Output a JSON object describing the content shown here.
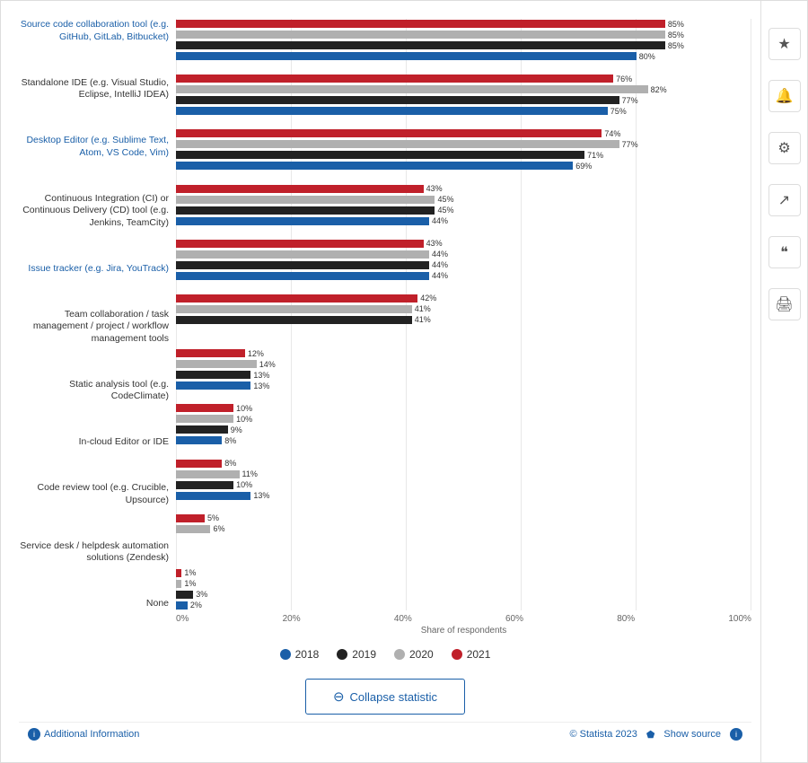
{
  "sidebar": {
    "icons": [
      {
        "name": "star-icon",
        "symbol": "★"
      },
      {
        "name": "bell-icon",
        "symbol": "🔔"
      },
      {
        "name": "gear-icon",
        "symbol": "⚙"
      },
      {
        "name": "share-icon",
        "symbol": "↗"
      },
      {
        "name": "quote-icon",
        "symbol": "❝"
      },
      {
        "name": "print-icon",
        "symbol": "🖨"
      }
    ]
  },
  "chart": {
    "categories": [
      {
        "label": "Source code collaboration tool (e.g. GitHub, GitLab, Bitbucket)",
        "isLink": true,
        "bars": [
          {
            "year": "2018",
            "color": "#1a5fa8",
            "value": 80,
            "label": "80%"
          },
          {
            "year": "2019",
            "color": "#222222",
            "value": 85,
            "label": "85%"
          },
          {
            "year": "2020",
            "color": "#b0b0b0",
            "value": 85,
            "label": "85%"
          },
          {
            "year": "2021",
            "color": "#c0202a",
            "value": 85,
            "label": "85%"
          }
        ]
      },
      {
        "label": "Standalone IDE (e.g. Visual Studio, Eclipse, IntelliJ IDEA)",
        "isLink": false,
        "bars": [
          {
            "year": "2018",
            "color": "#1a5fa8",
            "value": 75,
            "label": "75%"
          },
          {
            "year": "2019",
            "color": "#222222",
            "value": 77,
            "label": "77%"
          },
          {
            "year": "2020",
            "color": "#b0b0b0",
            "value": 82,
            "label": "82%"
          },
          {
            "year": "2021",
            "color": "#c0202a",
            "value": 76,
            "label": "76%"
          }
        ]
      },
      {
        "label": "Desktop Editor (e.g. Sublime Text, Atom, VS Code, Vim)",
        "isLink": true,
        "bars": [
          {
            "year": "2018",
            "color": "#1a5fa8",
            "value": 69,
            "label": "69%"
          },
          {
            "year": "2019",
            "color": "#222222",
            "value": 71,
            "label": "71%"
          },
          {
            "year": "2020",
            "color": "#b0b0b0",
            "value": 77,
            "label": "77%"
          },
          {
            "year": "2021",
            "color": "#c0202a",
            "value": 74,
            "label": "74%"
          }
        ]
      },
      {
        "label": "Continuous Integration (CI) or Continuous Delivery (CD) tool (e.g. Jenkins, TeamCity)",
        "isLink": false,
        "bars": [
          {
            "year": "2018",
            "color": "#1a5fa8",
            "value": 44,
            "label": "44%"
          },
          {
            "year": "2019",
            "color": "#222222",
            "value": 45,
            "label": "45%"
          },
          {
            "year": "2020",
            "color": "#b0b0b0",
            "value": 45,
            "label": "45%"
          },
          {
            "year": "2021",
            "color": "#c0202a",
            "value": 43,
            "label": "43%"
          }
        ]
      },
      {
        "label": "Issue tracker (e.g. Jira, YouTrack)",
        "isLink": true,
        "bars": [
          {
            "year": "2018",
            "color": "#1a5fa8",
            "value": 44,
            "label": "44%"
          },
          {
            "year": "2019",
            "color": "#222222",
            "value": 44,
            "label": "44%"
          },
          {
            "year": "2020",
            "color": "#b0b0b0",
            "value": 44,
            "label": "44%"
          },
          {
            "year": "2021",
            "color": "#c0202a",
            "value": 43,
            "label": "43%"
          }
        ]
      },
      {
        "label": "Team collaboration / task management / project / workflow management tools",
        "isLink": false,
        "bars": [
          {
            "year": "2018",
            "color": "#1a5fa8",
            "value": 0,
            "label": ""
          },
          {
            "year": "2019",
            "color": "#222222",
            "value": 41,
            "label": "41%"
          },
          {
            "year": "2020",
            "color": "#b0b0b0",
            "value": 41,
            "label": "41%"
          },
          {
            "year": "2021",
            "color": "#c0202a",
            "value": 42,
            "label": "42%"
          }
        ]
      },
      {
        "label": "Static analysis tool (e.g. CodeClimate)",
        "isLink": false,
        "bars": [
          {
            "year": "2018",
            "color": "#1a5fa8",
            "value": 13,
            "label": "13%"
          },
          {
            "year": "2019",
            "color": "#222222",
            "value": 13,
            "label": "13%"
          },
          {
            "year": "2020",
            "color": "#b0b0b0",
            "value": 14,
            "label": "14%"
          },
          {
            "year": "2021",
            "color": "#c0202a",
            "value": 12,
            "label": "12%"
          }
        ]
      },
      {
        "label": "In-cloud Editor or IDE",
        "isLink": false,
        "bars": [
          {
            "year": "2018",
            "color": "#1a5fa8",
            "value": 8,
            "label": "8%"
          },
          {
            "year": "2019",
            "color": "#222222",
            "value": 9,
            "label": "9%"
          },
          {
            "year": "2020",
            "color": "#b0b0b0",
            "value": 10,
            "label": "10%"
          },
          {
            "year": "2021",
            "color": "#c0202a",
            "value": 10,
            "label": "10%"
          }
        ]
      },
      {
        "label": "Code review tool (e.g. Crucible, Upsource)",
        "isLink": false,
        "bars": [
          {
            "year": "2018",
            "color": "#1a5fa8",
            "value": 13,
            "label": "13%"
          },
          {
            "year": "2019",
            "color": "#222222",
            "value": 10,
            "label": "10%"
          },
          {
            "year": "2020",
            "color": "#b0b0b0",
            "value": 11,
            "label": "11%"
          },
          {
            "year": "2021",
            "color": "#c0202a",
            "value": 8,
            "label": "8%"
          }
        ]
      },
      {
        "label": "Service desk / helpdesk automation solutions (Zendesk)",
        "isLink": false,
        "bars": [
          {
            "year": "2018",
            "color": "#1a5fa8",
            "value": 0,
            "label": ""
          },
          {
            "year": "2019",
            "color": "#222222",
            "value": 0,
            "label": ""
          },
          {
            "year": "2020",
            "color": "#b0b0b0",
            "value": 6,
            "label": "6%"
          },
          {
            "year": "2021",
            "color": "#c0202a",
            "value": 5,
            "label": "5%"
          }
        ]
      },
      {
        "label": "None",
        "isLink": false,
        "bars": [
          {
            "year": "2018",
            "color": "#1a5fa8",
            "value": 2,
            "label": "2%"
          },
          {
            "year": "2019",
            "color": "#222222",
            "value": 3,
            "label": "3%"
          },
          {
            "year": "2020",
            "color": "#b0b0b0",
            "value": 1,
            "label": "1%"
          },
          {
            "year": "2021",
            "color": "#c0202a",
            "value": 1,
            "label": "1%"
          }
        ]
      }
    ],
    "xAxisLabels": [
      "0%",
      "20%",
      "40%",
      "60%",
      "80%",
      "100%"
    ],
    "xAxisTitle": "Share of respondents",
    "maxValue": 100
  },
  "legend": [
    {
      "year": "2018",
      "color": "#1a5fa8"
    },
    {
      "year": "2019",
      "color": "#222222"
    },
    {
      "year": "2020",
      "color": "#b0b0b0"
    },
    {
      "year": "2021",
      "color": "#c0202a"
    }
  ],
  "collapse_button": {
    "label": "Collapse statistic",
    "symbol": "⊖"
  },
  "footer": {
    "additional_info": "Additional Information",
    "statista_credit": "© Statista 2023",
    "show_source": "Show source"
  }
}
